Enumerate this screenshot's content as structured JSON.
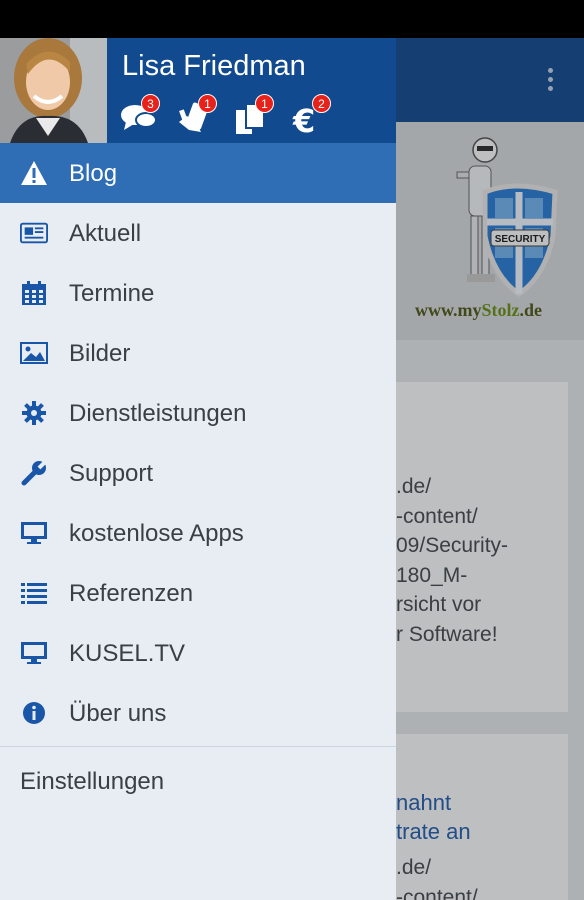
{
  "drawer": {
    "user_name": "Lisa Friedman",
    "header_icons": [
      {
        "icon": "chat-bubbles-icon",
        "badge": "3"
      },
      {
        "icon": "hand-holding-card-icon",
        "badge": "1"
      },
      {
        "icon": "copy-documents-icon",
        "badge": "1"
      },
      {
        "icon": "euro-icon",
        "badge": "2"
      }
    ],
    "menu": [
      {
        "label": "Blog",
        "icon": "warning-icon",
        "active": true
      },
      {
        "label": "Aktuell",
        "icon": "newspaper-icon"
      },
      {
        "label": "Termine",
        "icon": "calendar-icon"
      },
      {
        "label": "Bilder",
        "icon": "picture-icon"
      },
      {
        "label": "Dienstleistungen",
        "icon": "gear-icon"
      },
      {
        "label": "Support",
        "icon": "wrench-icon"
      },
      {
        "label": "kostenlose Apps",
        "icon": "monitor-icon"
      },
      {
        "label": "Referenzen",
        "icon": "list-icon"
      },
      {
        "label": "KUSEL.TV",
        "icon": "monitor-icon"
      },
      {
        "label": "Über uns",
        "icon": "info-icon"
      }
    ],
    "settings_label": "Einstellungen"
  },
  "background": {
    "banner_url_prefix": "www.my",
    "banner_url_accent": "Stolz",
    "banner_url_suffix": ".de",
    "banner_badge_text": "SECURITY",
    "card1_text": ".de/\n-content/\n09/Security-\n180_M-\nrsicht vor\nr Software!",
    "card2_title": "nahnt\ntrate an",
    "card2_text": ".de/\n-content/"
  },
  "colors": {
    "header_blue": "#124a90",
    "active_blue": "#2f6db5",
    "icon_blue": "#1a56a8",
    "badge_red": "#e8221b"
  }
}
